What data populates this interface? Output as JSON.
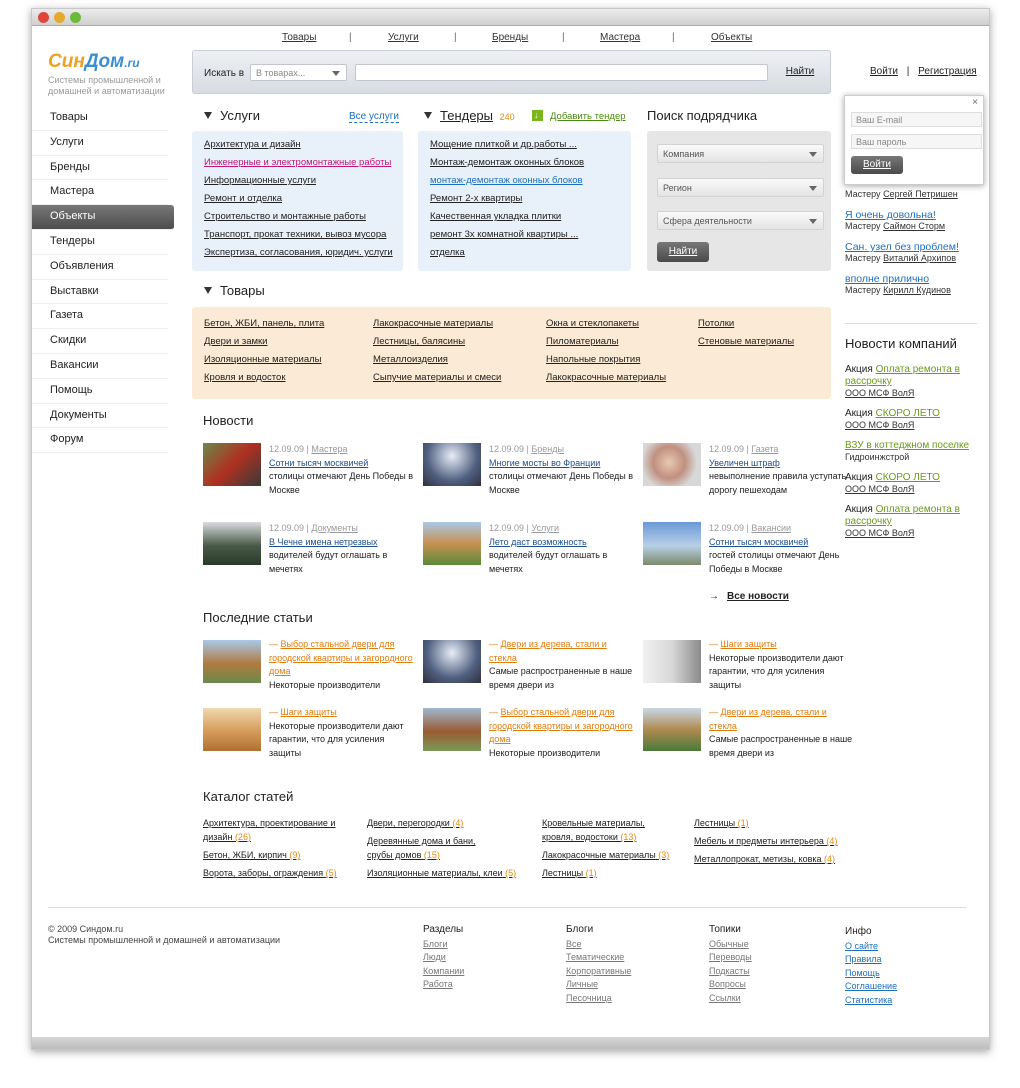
{
  "colors": {
    "accent_orange": "#f0a020",
    "accent_blue": "#3a8fd0",
    "link_blue": "#1e6fbf",
    "green": "#6a9a1a"
  },
  "topnav": [
    "Товары",
    "Услуги",
    "Бренды",
    "Мастера",
    "Объекты"
  ],
  "logo": {
    "part1": "Син",
    "part2": "Дом",
    "tld": ".ru",
    "subtitle": "Системы промышленной и домашней и автоматизации"
  },
  "search": {
    "label": "Искать в",
    "select": "В товарах...",
    "button": "Найти"
  },
  "auth": {
    "login": "Войти",
    "register": "Регистрация"
  },
  "popup": {
    "email": "Ваш E-mail",
    "password": "Ваш пароль",
    "button": "Войти",
    "close": "×"
  },
  "leftnav": [
    "Товары",
    "Услуги",
    "Бренды",
    "Мастера",
    "Объекты",
    "Тендеры",
    "Объявления",
    "Выставки",
    "Газета",
    "Скидки",
    "Вакансии",
    "Помощь",
    "Документы",
    "Форум"
  ],
  "services": {
    "title": "Услуги",
    "all": "Все услуги",
    "items": [
      "Архитектура и дизайн",
      "Инженерные и электромонтажные работы",
      "Информационные услуги",
      "Ремонт и отделка",
      "Строительство и монтажные работы",
      "Транспорт, прокат техники, вывоз мусора",
      "Экспертиза, согласования, юридич. услуги"
    ]
  },
  "tenders": {
    "title": "Тендеры",
    "count": "240",
    "add": "Добавить тендер",
    "items": [
      "Мощение плиткой и др.работы ...",
      "Монтаж-демонтаж оконных блоков",
      "монтаж-демонтаж оконных блоков",
      "Ремонт 2-х квартиры",
      "Качественная укладка плитки",
      "ремонт 3х комнатной квартиры ...",
      "отделка"
    ]
  },
  "contractor": {
    "title": "Поиск подрядчика",
    "company": "Компания",
    "region": "Регион",
    "sphere": "Сфера деятельности",
    "button": "Найти"
  },
  "reviews": [
    {
      "title": "",
      "master_label": "Мастеру",
      "master": "Сергей Петришен"
    },
    {
      "title": "Я очень довольна!",
      "master_label": "Мастеру",
      "master": "Саймон Сторм"
    },
    {
      "title": "Сан. узел без проблем!",
      "master_label": "Мастеру",
      "master": "Виталий Архипов"
    },
    {
      "title": "вполне прилично",
      "master_label": "Мастеру",
      "master": "Кирилл Кудинов"
    }
  ],
  "company_news": {
    "title": "Новости компаний",
    "items": [
      {
        "prefix": "Акция",
        "link": "Оплата ремонта в рассрочку",
        "org": "ООО МСФ ВолЯ"
      },
      {
        "prefix": "Акция",
        "link": "СКОРО ЛЕТО",
        "org": "ООО МСФ ВолЯ"
      },
      {
        "prefix": "",
        "link": "ВЗУ в коттеджном поселке",
        "org": "Гидроинжстрой"
      },
      {
        "prefix": "Акция",
        "link": "СКОРО ЛЕТО",
        "org": "ООО МСФ ВолЯ"
      },
      {
        "prefix": "Акция",
        "link": "Оплата ремонта в рассрочку",
        "org": "ООО МСФ ВолЯ"
      }
    ]
  },
  "goods": {
    "title": "Товары",
    "cols": [
      [
        "Бетон, ЖБИ, панель, плита",
        "Двери и замки",
        "Изоляционные материалы",
        "Кровля и водосток"
      ],
      [
        "Лакокрасочные материалы",
        "Лестницы, балясины",
        "Металлоизделия",
        "Сыпучие материалы и смеси"
      ],
      [
        "Окна и стеклопакеты",
        "Пиломатериалы",
        "Напольные покрытия",
        "Лакокрасочные материалы"
      ],
      [
        "Потолки",
        "Стеновые материалы"
      ]
    ]
  },
  "news": {
    "title": "Новости",
    "all": "Все новости",
    "items": [
      {
        "date": "12.09.09",
        "cat": "Мастера",
        "title": "Сотни тысяч москвичей",
        "text": "столицы отмечают День Победы в Москве"
      },
      {
        "date": "12.09.09",
        "cat": "Бренды",
        "title": "Многие мосты во Франции",
        "text": "столицы отмечают День Победы в Москве"
      },
      {
        "date": "12.09.09",
        "cat": "Газета",
        "title": "Увеличен штраф",
        "text": "невыполнение правила уступать дорогу пешеходам"
      },
      {
        "date": "12.09.09",
        "cat": "Документы",
        "title": "В Чечне имена нетрезвых",
        "text": "водителей будут оглашать в мечетях"
      },
      {
        "date": "12.09.09",
        "cat": "Услуги",
        "title": "Лето даст возможность",
        "text": "водителей будут оглашать в мечетях"
      },
      {
        "date": "12.09.09",
        "cat": "Вакансии",
        "title": "Сотни тысяч москвичей",
        "text": "гостей столицы отмечают День Победы в Москве"
      }
    ]
  },
  "articles": {
    "title": "Последние статьи",
    "items": [
      {
        "title": "Выбор стальной двери для городской квартиры и загородного дома",
        "text": "Некоторые производители"
      },
      {
        "title": "Двери из дерева, стали и стекла",
        "text": "Самые распространенные в наше время двери из"
      },
      {
        "title": "Шаги защиты",
        "text": "Некоторые производители дают гарантии, что для усиления защиты"
      },
      {
        "title": "Шаги защиты",
        "text": "Некоторые производители дают гарантии, что для усиления защиты"
      },
      {
        "title": "Выбор стальной двери для городской квартиры и загородного дома",
        "text": "Некоторые производители"
      },
      {
        "title": "Двери из дерева, стали и стекла",
        "text": "Самые распространенные в наше время двери из"
      }
    ]
  },
  "catalog": {
    "title": "Каталог статей",
    "items": [
      {
        "name": "Архитектура, проектирование и дизайн",
        "count": "(26)"
      },
      {
        "name": "Бетон, ЖБИ, кирпич",
        "count": "(9)"
      },
      {
        "name": "Ворота, заборы, ограждения",
        "count": "(5)"
      },
      {
        "name": "Двери, перегородки",
        "count": "(4)"
      },
      {
        "name": "Деревянные дома и бани, срубы домов",
        "count": "(15)"
      },
      {
        "name": "Изоляционные материалы, клеи",
        "count": "(5)"
      },
      {
        "name": "Кровельные материалы, кровля, водостоки",
        "count": "(13)"
      },
      {
        "name": "Лакокрасочные материалы",
        "count": "(3)"
      },
      {
        "name": "Лестницы",
        "count": "(1)"
      },
      {
        "name": "Лестницы",
        "count": "(1)"
      },
      {
        "name": "Мебель и предметы интерьера",
        "count": "(4)"
      },
      {
        "name": "Металлопрокат, метизы, ковка",
        "count": "(4)"
      }
    ]
  },
  "footer": {
    "copyright": "© 2009 Синдом.ru",
    "tagline": "Системы промышленной и домашней и автоматизации",
    "cols": [
      {
        "title": "Разделы",
        "links": [
          "Блоги",
          "Люди",
          "Компании",
          "Работа"
        ]
      },
      {
        "title": "Блоги",
        "links": [
          "Все",
          "Тематические",
          "Корпоративные",
          "Личные",
          "Песочница"
        ]
      },
      {
        "title": "Топики",
        "links": [
          "Обычные",
          "Переводы",
          "Подкасты",
          "Вопросы",
          "Ссылки"
        ]
      },
      {
        "title": "Инфо",
        "links": [
          "О сайте",
          "Правила",
          "Помощь",
          "Соглашение",
          "Статистика"
        ]
      }
    ]
  }
}
